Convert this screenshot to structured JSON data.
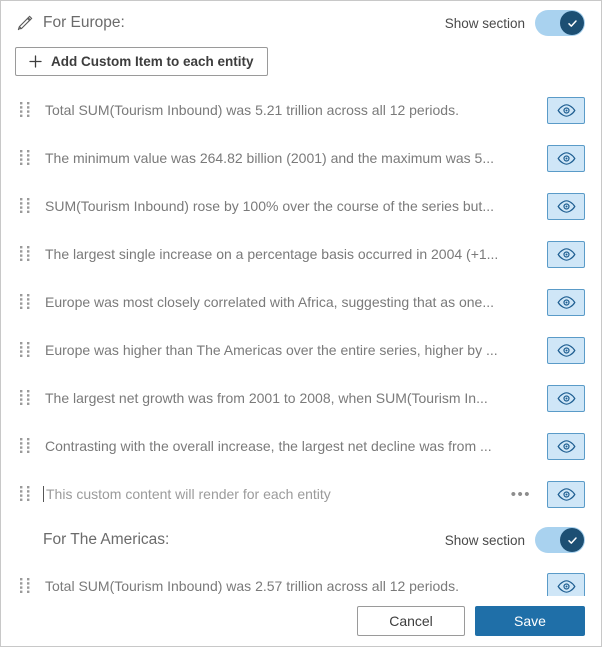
{
  "dialog": {
    "show_section_label": "Show section",
    "add_button_label": "Add Custom Item to each entity"
  },
  "sections": [
    {
      "title": "For Europe:",
      "has_edit_pencil": true,
      "show_section": true,
      "has_add_button": true,
      "items": [
        {
          "text": "Total SUM(Tourism Inbound) was 5.21 trillion across all 12 periods.",
          "placeholder": false,
          "has_menu": false
        },
        {
          "text": "The minimum value was 264.82 billion (2001) and the maximum was 5...",
          "placeholder": false,
          "has_menu": false
        },
        {
          "text": "SUM(Tourism Inbound) rose by 100% over the course of the series but...",
          "placeholder": false,
          "has_menu": false
        },
        {
          "text": "The largest single increase on a percentage basis occurred in 2004 (+1...",
          "placeholder": false,
          "has_menu": false
        },
        {
          "text": "Europe was most closely correlated with Africa, suggesting that as one...",
          "placeholder": false,
          "has_menu": false
        },
        {
          "text": "Europe was higher than The Americas over the entire series, higher by ...",
          "placeholder": false,
          "has_menu": false
        },
        {
          "text": "The largest net growth was from 2001 to 2008, when SUM(Tourism In...",
          "placeholder": false,
          "has_menu": false
        },
        {
          "text": "Contrasting with the overall increase, the largest net decline was from ...",
          "placeholder": false,
          "has_menu": false
        },
        {
          "text": "This custom content will render for each entity",
          "placeholder": true,
          "has_menu": true,
          "menu_label": "•••"
        }
      ]
    },
    {
      "title": "For The Americas:",
      "has_edit_pencil": false,
      "show_section": true,
      "has_add_button": false,
      "items": [
        {
          "text": "Total SUM(Tourism Inbound) was 2.57 trillion across all 12 periods.",
          "placeholder": false,
          "has_menu": false
        }
      ]
    }
  ],
  "footer": {
    "cancel_label": "Cancel",
    "save_label": "Save"
  },
  "colors": {
    "accent": "#1f6fa8",
    "toggle_track": "#a9d2ef",
    "toggle_knob": "#1c4f73",
    "eye_fill": "#cfe6f7",
    "eye_border": "#5a9bc8",
    "eye_glyph": "#1f5f92",
    "text_muted": "#7a7a7a"
  }
}
